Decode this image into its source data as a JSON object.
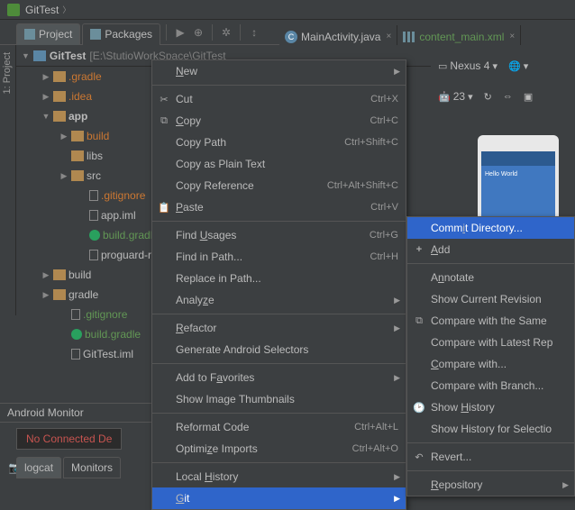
{
  "titlebar": {
    "title": "GitTest"
  },
  "projectTabs": {
    "project": "Project",
    "packages": "Packages"
  },
  "editorTabs": {
    "main": "MainActivity.java",
    "content": "content_main.xml"
  },
  "crumb": {
    "root": "GitTest",
    "path": "[E:\\StutioWorkSpace\\GitTest"
  },
  "tree": {
    "gradleDir": ".gradle",
    "idea": ".idea",
    "app": "app",
    "build": "build",
    "libs": "libs",
    "src": "src",
    "gitignore": ".gitignore",
    "appiml": "app.iml",
    "buildgradle": "build.gradle",
    "proguard": "proguard-ru",
    "build2": "build",
    "gradle2": "gradle",
    "gitignore2": ".gitignore",
    "buildgradle2": "build.gradle",
    "gittestiml": "GitTest.iml"
  },
  "context1": {
    "new": "New",
    "cut": "Cut",
    "cut_sc": "Ctrl+X",
    "copy": "Copy",
    "copy_sc": "Ctrl+C",
    "copypath": "Copy Path",
    "copypath_sc": "Ctrl+Shift+C",
    "copyplain": "Copy as Plain Text",
    "copyref": "Copy Reference",
    "copyref_sc": "Ctrl+Alt+Shift+C",
    "paste": "Paste",
    "paste_sc": "Ctrl+V",
    "findusages": "Find Usages",
    "findusages_sc": "Ctrl+G",
    "findinpath": "Find in Path...",
    "findinpath_sc": "Ctrl+H",
    "replaceinpath": "Replace in Path...",
    "analyze": "Analyze",
    "refactor": "Refactor",
    "genandroid": "Generate Android Selectors",
    "addfav": "Add to Favorites",
    "showthumb": "Show Image Thumbnails",
    "reformat": "Reformat Code",
    "reformat_sc": "Ctrl+Alt+L",
    "optimize": "Optimize Imports",
    "optimize_sc": "Ctrl+Alt+O",
    "localhist": "Local History",
    "git": "Git"
  },
  "context2": {
    "commit": "Commit Directory...",
    "add": "Add",
    "annotate": "Annotate",
    "showrev": "Show Current Revision",
    "cmpsame": "Compare with the Same",
    "cmplatest": "Compare with Latest Rep",
    "cmpwith": "Compare with...",
    "cmpbranch": "Compare with Branch...",
    "showhist": "Show History",
    "showhistsel": "Show History for Selectio",
    "revert": "Revert...",
    "repo": "Repository"
  },
  "rightTools": {
    "nexus": "Nexus 4",
    "api": "23"
  },
  "monitor": {
    "label": "Android Monitor",
    "noconn": "No Connected De"
  },
  "bottomTabs": {
    "logcat": "logcat",
    "monitors": "Monitors"
  },
  "sideStrip": {
    "proj": "1: Project"
  }
}
